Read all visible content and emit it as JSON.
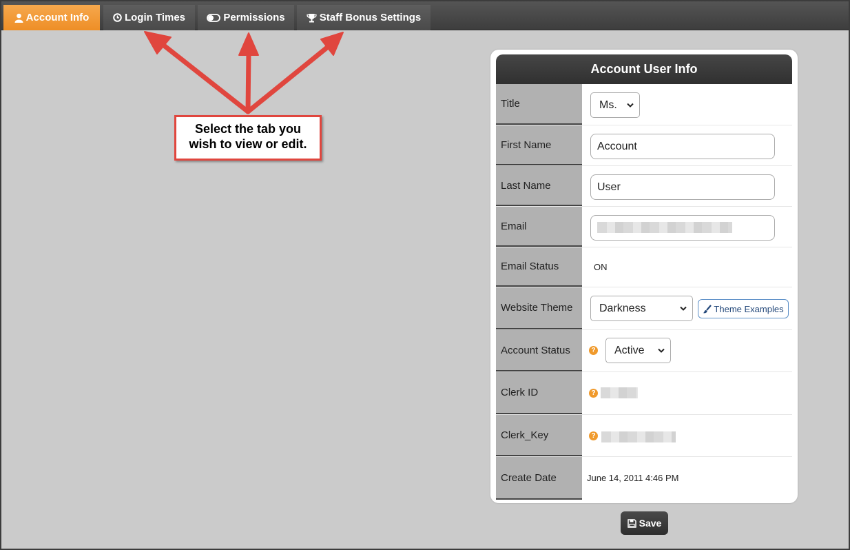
{
  "tabs": [
    {
      "label": "Account Info",
      "icon": "user-icon",
      "active": true
    },
    {
      "label": "Login Times",
      "icon": "clock-icon",
      "active": false
    },
    {
      "label": "Permissions",
      "icon": "toggle-icon",
      "active": false
    },
    {
      "label": "Staff Bonus Settings",
      "icon": "trophy-icon",
      "active": false
    }
  ],
  "callout": {
    "line1": "Select the tab you",
    "line2": "wish to view or edit."
  },
  "panel": {
    "title": "Account User Info",
    "fields": {
      "title": {
        "label": "Title",
        "value": "Ms."
      },
      "first_name": {
        "label": "First Name",
        "value": "Account"
      },
      "last_name": {
        "label": "Last Name",
        "value": "User"
      },
      "email": {
        "label": "Email"
      },
      "email_status": {
        "label": "Email Status",
        "value": "ON"
      },
      "website_theme": {
        "label": "Website Theme",
        "value": "Darkness",
        "button": "Theme Examples"
      },
      "account_status": {
        "label": "Account Status",
        "value": "Active"
      },
      "clerk_id": {
        "label": "Clerk ID"
      },
      "clerk_key": {
        "label": "Clerk_Key"
      },
      "create_date": {
        "label": "Create Date",
        "value": "June 14, 2011 4:46 PM"
      }
    }
  },
  "save_label": "Save",
  "colors": {
    "active_tab": "#ee8e26",
    "annotation": "#e0463e",
    "help_icon": "#f09a2c"
  }
}
